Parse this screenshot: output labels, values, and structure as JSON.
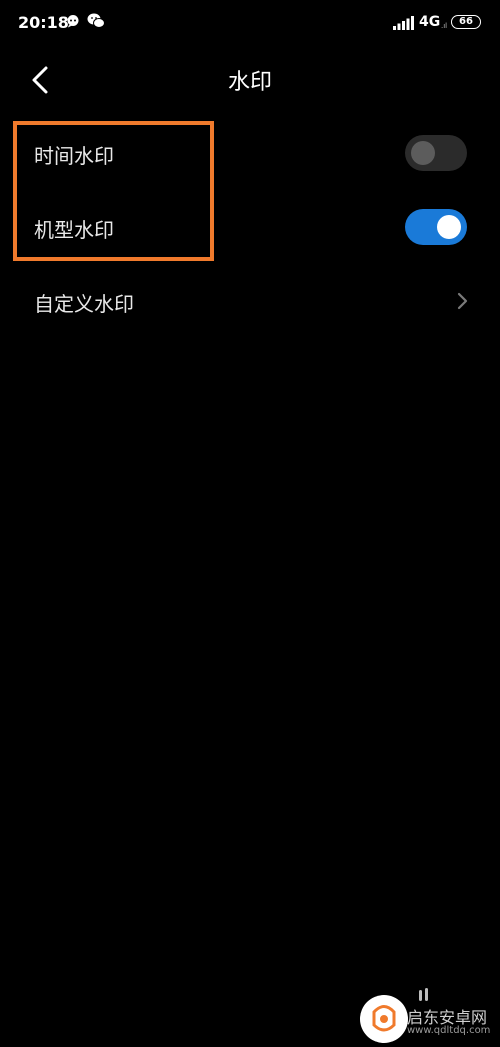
{
  "status_bar": {
    "time": "20:18",
    "network": "4G",
    "network_sub": ".ıl",
    "battery": "66",
    "icons": [
      "message-icon",
      "wechat-icon",
      "signal-icon"
    ]
  },
  "header": {
    "title": "水印",
    "back_icon": "chevron-left-icon"
  },
  "settings": {
    "time_watermark": {
      "label": "时间水印",
      "enabled": false
    },
    "model_watermark": {
      "label": "机型水印",
      "enabled": true
    },
    "custom_watermark": {
      "label": "自定义水印",
      "icon": "chevron-right-icon"
    }
  },
  "annotation": {
    "highlight_color": "#f07a2c"
  },
  "watermark": {
    "name": "启东安卓网",
    "url": "www.qdltdq.com"
  },
  "colors": {
    "background": "#000000",
    "toggle_on": "#1a7ad8",
    "toggle_off": "#2b2b2b"
  }
}
